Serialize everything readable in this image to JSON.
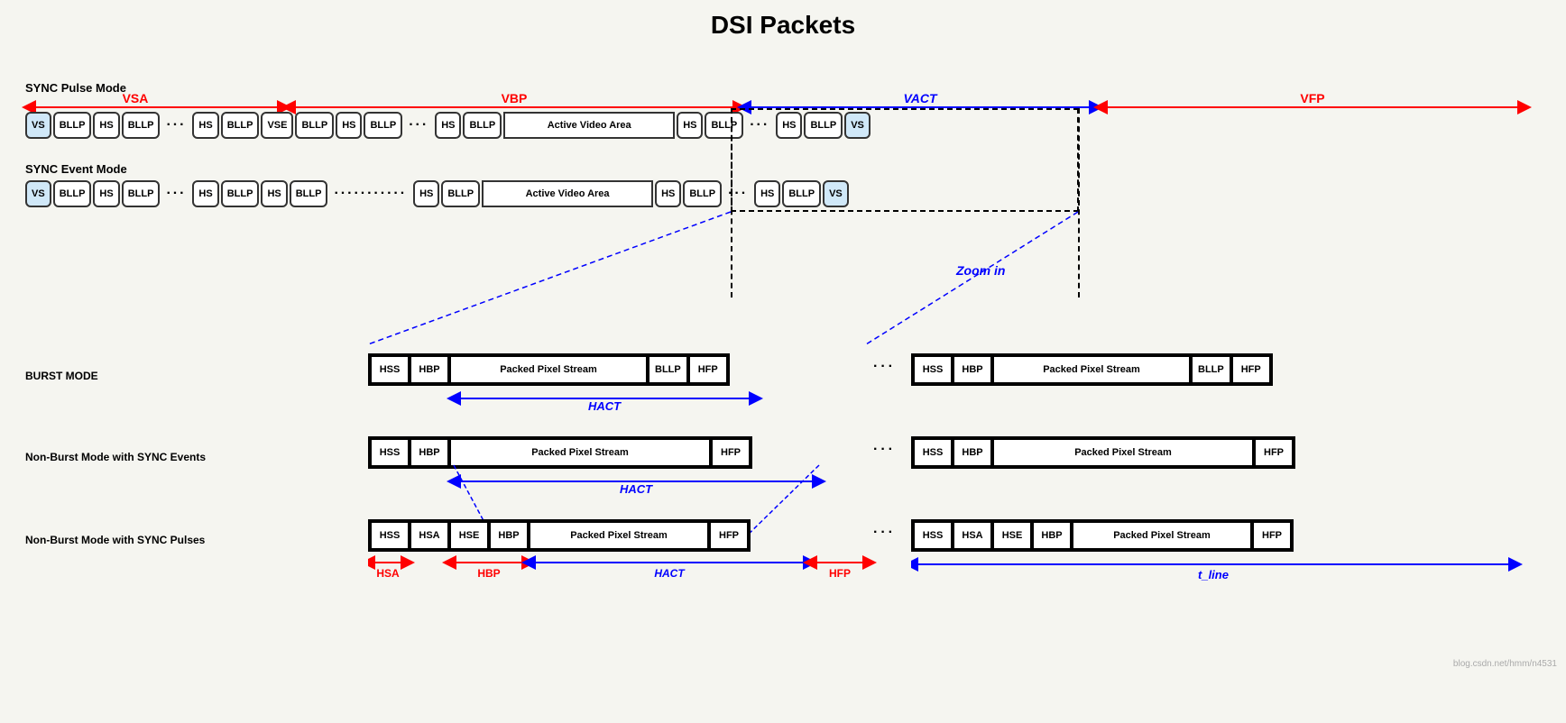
{
  "title": "DSI Packets",
  "top": {
    "sync_pulse_label": "SYNC Pulse Mode",
    "sync_event_label": "SYNC Event Mode",
    "vsa_label": "VSA",
    "vbp_label": "VBP",
    "vact_label": "VACT",
    "vfp_label": "VFP",
    "zoom_label": "Zoom in",
    "active_video_area": "Active Video Area",
    "row1_packets": [
      "VS",
      "BLLP",
      "HS",
      "BLLP",
      "...",
      "HS",
      "BLLP",
      "VSE",
      "BLLP",
      "HS",
      "BLLP",
      "...",
      "HS",
      "BLLP",
      "Active Video Area",
      "HS",
      "BLLP",
      "...",
      "HS",
      "BLLP",
      "VS"
    ],
    "row2_packets": [
      "VS",
      "BLLP",
      "HS",
      "BLLP",
      "...",
      "HS",
      "BLLP",
      "HS",
      "BLLP",
      "...",
      "HS",
      "BLLP",
      "Active Video Area",
      "HS",
      "BLLP",
      "...",
      "HS",
      "BLLP",
      "VS"
    ]
  },
  "burst_mode": {
    "label": "BURST MODE",
    "group1": [
      "HSS",
      "HBP",
      "Packed Pixel Stream",
      "BLLP",
      "HFP"
    ],
    "group2": [
      "HSS",
      "HBP",
      "Packed Pixel Stream",
      "BLLP",
      "HFP"
    ],
    "hact_label": "HACT"
  },
  "non_burst_sync_events": {
    "label": "Non-Burst Mode with SYNC Events",
    "group1": [
      "HSS",
      "HBP",
      "Packed Pixel Stream",
      "HFP"
    ],
    "group2": [
      "HSS",
      "HBP",
      "Packed Pixel Stream",
      "HFP"
    ],
    "hact_label": "HACT"
  },
  "non_burst_sync_pulses": {
    "label": "Non-Burst Mode with SYNC Pulses",
    "group1": [
      "HSS",
      "HSA",
      "HSE",
      "HBP",
      "Packed Pixel Stream",
      "HFP"
    ],
    "group2": [
      "HSS",
      "HSA",
      "HSE",
      "HBP",
      "Packed Pixel Stream",
      "HFP"
    ],
    "hsa_label": "HSA",
    "hbp_label": "HBP",
    "hact_label": "HACT",
    "hfp_label": "HFP",
    "tline_label": "t_line"
  }
}
